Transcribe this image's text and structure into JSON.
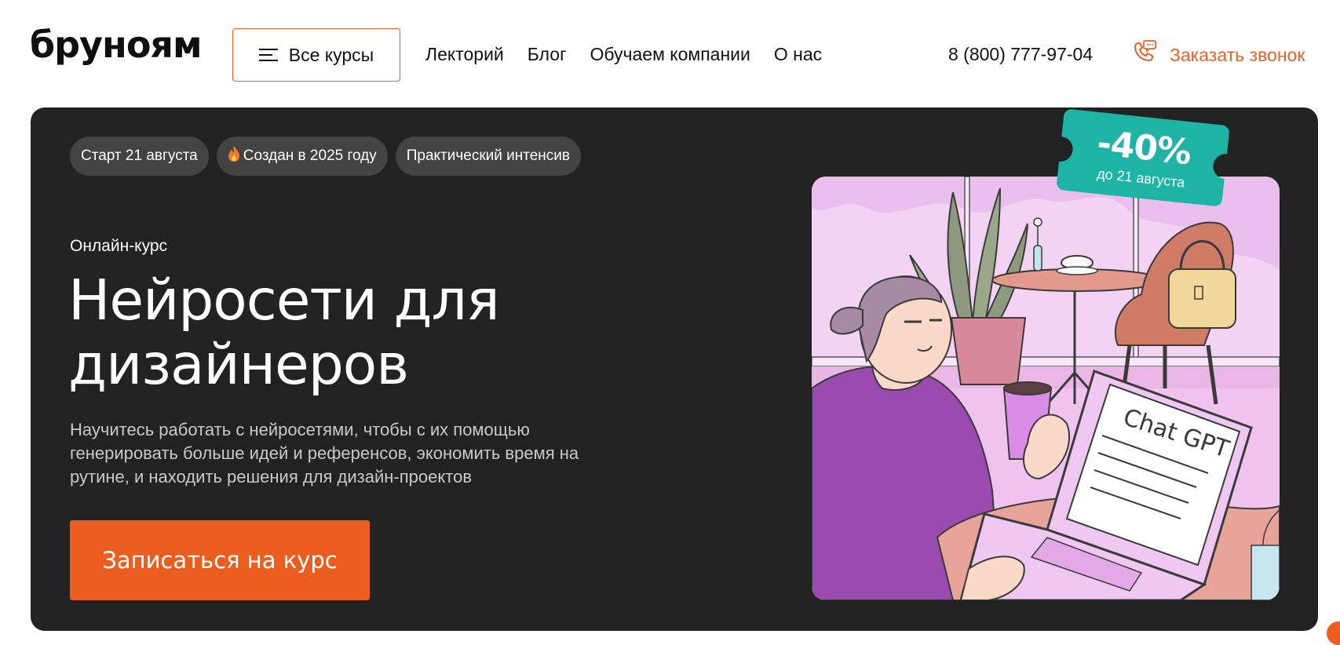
{
  "header": {
    "logo": "бруноям",
    "courses_button": "Все курсы",
    "nav": [
      "Лекторий",
      "Блог",
      "Обучаем компании",
      "О нас"
    ],
    "phone": "8 (800) 777-97-04",
    "callback": "Заказать звонок"
  },
  "hero": {
    "tags": [
      {
        "label": "Старт 21 августа"
      },
      {
        "label": "Создан в 2025 году",
        "icon": "fire-icon"
      },
      {
        "label": "Практический интенсив"
      }
    ],
    "subtitle": "Онлайн-курс",
    "title_line1": "Нейросети для",
    "title_line2": "дизайнеров",
    "description": "Научитесь работать с нейросетями, чтобы с их помощью генерировать больше идей и референсов, экономить время на рутине, и находить решения для дизайн-проектов",
    "cta": "Записаться на курс"
  },
  "discount": {
    "percent": "-40%",
    "until": "до 21 августа"
  },
  "illustration": {
    "screen_text": "Chat GPT"
  },
  "colors": {
    "accent": "#ec5e1f",
    "hero_bg": "#222222",
    "tag_bg": "#434343",
    "ticket": "#1db3a5",
    "illustration_bg": "#f3d3f3"
  }
}
